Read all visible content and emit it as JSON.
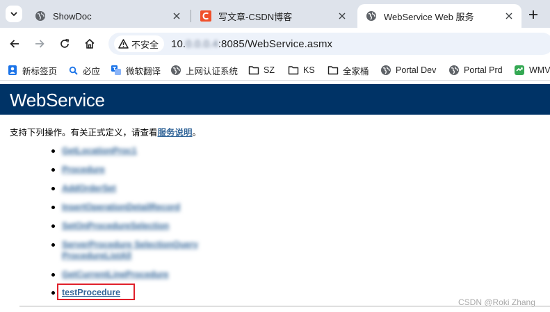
{
  "tabs": [
    {
      "title": "ShowDoc",
      "icon": "globe-icon",
      "active": false
    },
    {
      "title": "写文章-CSDN博客",
      "icon": "csdn-icon",
      "active": false
    },
    {
      "title": "WebService Web 服务",
      "icon": "globe-icon",
      "active": true
    }
  ],
  "toolbar": {
    "security_label": "不安全",
    "url_prefix": "10.",
    "url_hidden": "0.0.0.4",
    "url_suffix": ":8085/WebService.asmx"
  },
  "bookmarks": [
    {
      "label": "新标签页",
      "icon": "bookmark-icon"
    },
    {
      "label": "必应",
      "icon": "search-icon"
    },
    {
      "label": "微软翻译",
      "icon": "translate-icon"
    },
    {
      "label": "上网认证系统",
      "icon": "globe-icon"
    },
    {
      "label": "SZ",
      "icon": "folder-icon"
    },
    {
      "label": "KS",
      "icon": "folder-icon"
    },
    {
      "label": "全家桶",
      "icon": "folder-icon"
    },
    {
      "label": "Portal Dev",
      "icon": "globe-icon"
    },
    {
      "label": "Portal Prd",
      "icon": "globe-icon"
    },
    {
      "label": "WMV",
      "icon": "sync-icon"
    }
  ],
  "page": {
    "heading": "WebService",
    "intro_text": "支持下列操作。有关正式定义，请查看",
    "intro_link": "服务说明",
    "intro_end": "。",
    "operations": [
      "GetLocationProc1",
      "Procedure",
      "AddOrderSet",
      "InsertOperationDetailRecord",
      "SetOnProcedureSelection",
      "ServerProcedure SelectionQuery ProcedureListAll",
      "GetCurrentLineProcedure",
      "testProcedure"
    ],
    "watermark": "CSDN @Roki Zhang"
  },
  "colors": {
    "heading_bg": "#003366",
    "link": "#336699",
    "highlight": "#e0202a"
  }
}
